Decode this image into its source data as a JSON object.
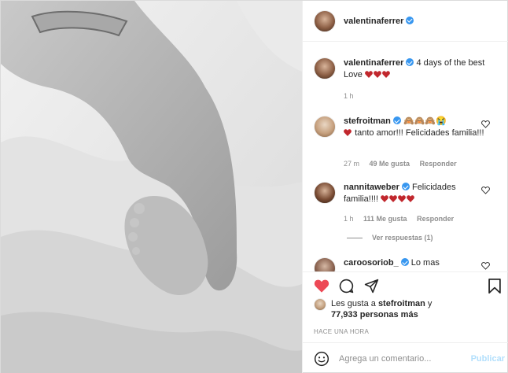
{
  "post": {
    "author": "valentinaferrer",
    "caption_text": "4 days of the best Love",
    "caption_time": "1 h"
  },
  "comments": [
    {
      "user": "stefroitman",
      "emoji_prefix": "🙈🙈🙈😭",
      "text": "tanto amor!!! Felicidades familia!!!",
      "time": "27 m",
      "likes": "49 Me gusta",
      "reply": "Responder"
    },
    {
      "user": "nannitaweber",
      "text": "Felicidades familia!!!!",
      "time": "1 h",
      "likes": "111 Me gusta",
      "reply": "Responder"
    },
    {
      "user": "caroosoriob_",
      "text": "Lo mas"
    }
  ],
  "view_replies": "Ver respuestas (1)",
  "likes_line": {
    "prefix": "Les gusta a",
    "user": "stefroitman",
    "middle": "y",
    "count": "77,933 personas más"
  },
  "time_ago": "HACE UNA HORA",
  "add_comment": {
    "placeholder": "Agrega un comentario...",
    "publish": "Publicar"
  },
  "icons": {
    "more": "more-options-icon",
    "like": "heart-icon",
    "comment": "comment-icon",
    "share": "share-icon",
    "save": "bookmark-icon",
    "emoji": "emoji-icon"
  },
  "colors": {
    "like_red": "#ed4956",
    "verified_blue": "#3897f0",
    "publish_disabled": "#b2dffc"
  }
}
